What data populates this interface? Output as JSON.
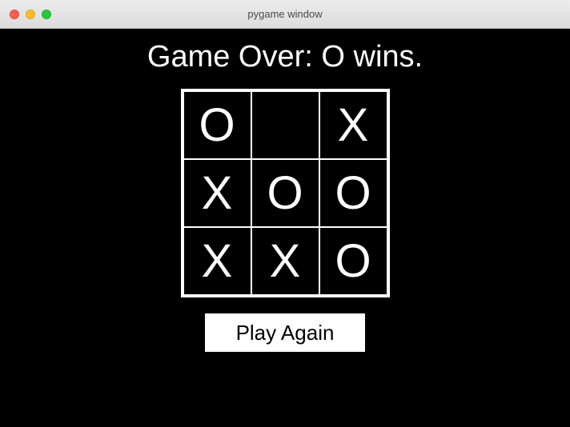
{
  "window": {
    "title": "pygame window"
  },
  "game": {
    "status_text": "Game Over: O wins.",
    "board": [
      [
        "O",
        "",
        "X"
      ],
      [
        "X",
        "O",
        "O"
      ],
      [
        "X",
        "X",
        "O"
      ]
    ],
    "play_again_label": "Play Again"
  }
}
